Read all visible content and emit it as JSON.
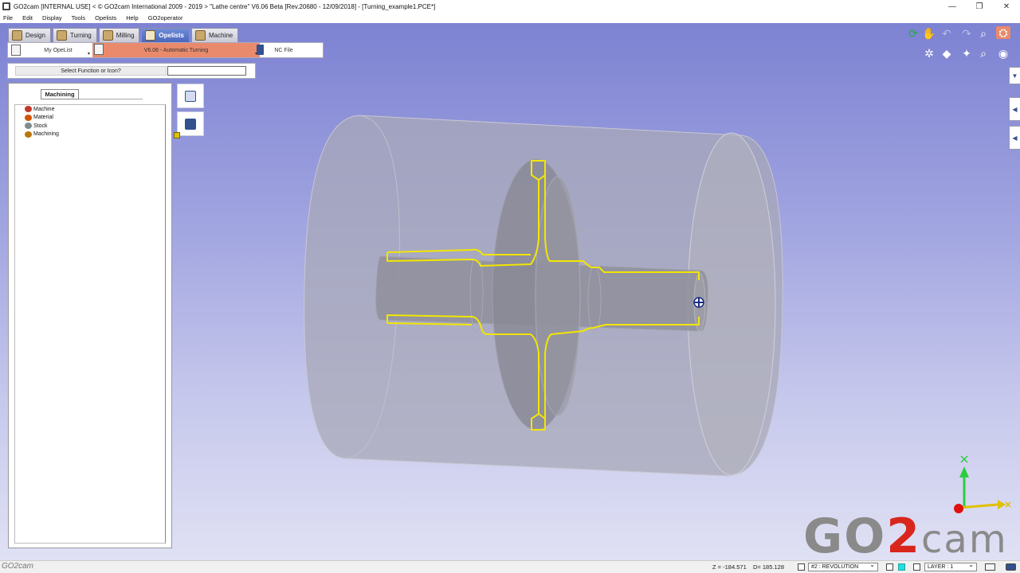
{
  "window": {
    "title": "GO2cam [INTERNAL USE] < © GO2cam International 2009 - 2019 >    \"Lathe centre\"    V6.06 Beta [Rev.20680 - 12/09/2018]     - [Turning_example1.PCE*]",
    "minimize": "—",
    "maximize": "❐",
    "close": "✕"
  },
  "menu": [
    "File",
    "Edit",
    "Display",
    "Tools",
    "Opelists",
    "Help",
    "GO2operator"
  ],
  "tabs": [
    {
      "label": "Design",
      "active": false
    },
    {
      "label": "Turning",
      "active": false
    },
    {
      "label": "Milling",
      "active": false
    },
    {
      "label": "Opelists",
      "active": true
    },
    {
      "label": "Machine",
      "active": false
    }
  ],
  "opelist": {
    "my_opelist": "My OpeList",
    "automatic": "V6.06 - Automatic Turning",
    "nc_file": "NC File"
  },
  "select": {
    "label": "Select Function or Icon?",
    "value": ""
  },
  "panel": {
    "tab": "Machining",
    "tree": [
      {
        "label": "Machine",
        "color": "#c0392b"
      },
      {
        "label": "Material",
        "color": "#d35400"
      },
      {
        "label": "Stock",
        "color": "#7f8c8d"
      },
      {
        "label": "Machining",
        "color": "#b9770e"
      }
    ]
  },
  "axes": {
    "x_color": "#f0c000",
    "y_color": "#2ecc40",
    "z_color": "#e01010"
  },
  "logo": {
    "part1": "GO",
    "part2": "2",
    "part3": "cam"
  },
  "status": {
    "brand": "GO2cam",
    "z": "Z = -184.571",
    "d": "D= 185.128",
    "revolution": "#2 : REVOLUTION",
    "layer": "LAYER : 1"
  },
  "colors": {
    "accent_tab": "#4a66bd",
    "opelist_active": "#ea8a6c",
    "profile": "#f2e600"
  }
}
